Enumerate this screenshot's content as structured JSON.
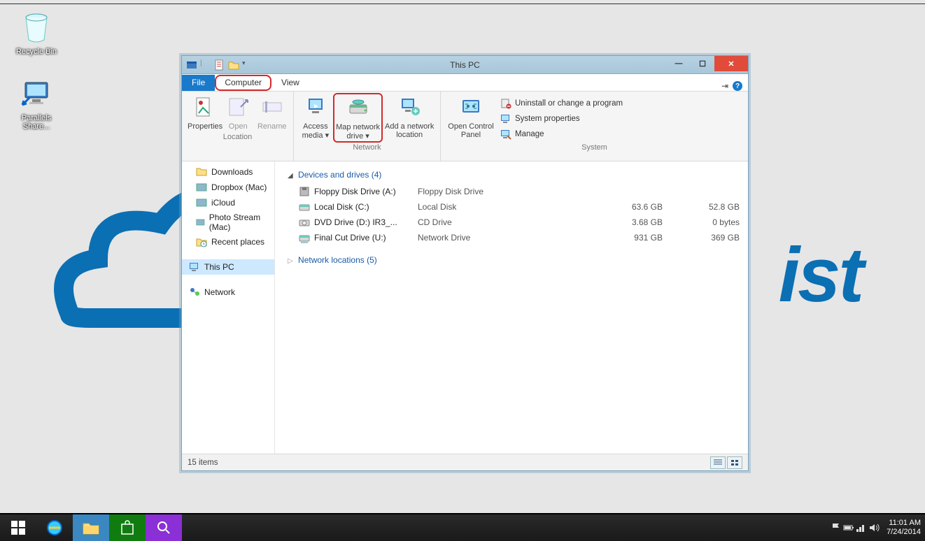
{
  "desktop": {
    "icons": [
      {
        "name": "Recycle Bin"
      },
      {
        "name": "Parallels Share..."
      }
    ],
    "bg_text": "ist"
  },
  "window": {
    "title": "This PC",
    "tabs": {
      "file": "File",
      "computer": "Computer",
      "view": "View"
    },
    "ribbon": {
      "location": {
        "label": "Location",
        "properties": "Properties",
        "open": "Open",
        "rename": "Rename"
      },
      "network": {
        "label": "Network",
        "access_media": "Access media ▾",
        "map_drive": "Map network drive ▾",
        "add_location": "Add a network location"
      },
      "system": {
        "label": "System",
        "control_panel": "Open Control Panel",
        "uninstall": "Uninstall or change a program",
        "sys_props": "System properties",
        "manage": "Manage"
      }
    },
    "nav": {
      "downloads": "Downloads",
      "dropbox": "Dropbox (Mac)",
      "icloud": "iCloud",
      "photostream": "Photo Stream (Mac)",
      "recent": "Recent places",
      "thispc": "This PC",
      "network": "Network"
    },
    "content": {
      "devices_header": "Devices and drives (4)",
      "netloc_header": "Network locations (5)",
      "drives": [
        {
          "name": "Floppy Disk Drive (A:)",
          "type": "Floppy Disk Drive",
          "size": "",
          "free": ""
        },
        {
          "name": "Local Disk (C:)",
          "type": "Local Disk",
          "size": "63.6 GB",
          "free": "52.8 GB"
        },
        {
          "name": "DVD Drive (D:) IR3_...",
          "type": "CD Drive",
          "size": "3.68 GB",
          "free": "0 bytes"
        },
        {
          "name": "Final Cut Drive (U:)",
          "type": "Network Drive",
          "size": "931 GB",
          "free": "369 GB"
        }
      ]
    },
    "status": "15 items"
  },
  "taskbar": {
    "time": "11:01 AM",
    "date": "7/24/2014"
  }
}
